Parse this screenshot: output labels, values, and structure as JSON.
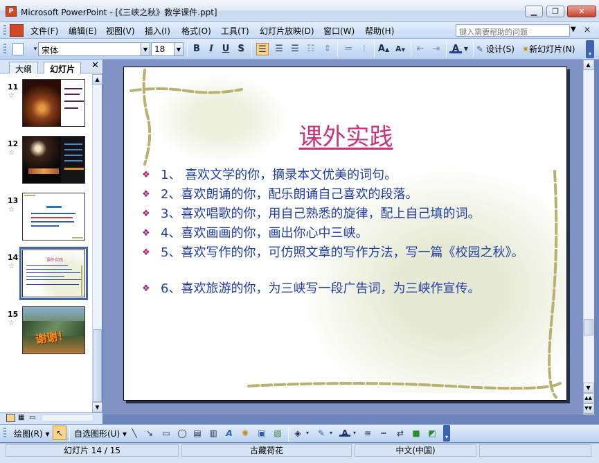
{
  "window": {
    "app_icon_letter": "P",
    "title": "Microsoft PowerPoint - [《三峡之秋》教学课件.ppt]",
    "min_label": "▁",
    "max_label": "❐",
    "close_label": "✕"
  },
  "menu": {
    "items": [
      "文件(F)",
      "编辑(E)",
      "视图(V)",
      "插入(I)",
      "格式(O)",
      "工具(T)",
      "幻灯片放映(D)",
      "窗口(W)",
      "帮助(H)"
    ],
    "help_placeholder": "键入需要帮助的问题",
    "doc_close": "✕"
  },
  "toolbar": {
    "font_name": "宋体",
    "font_size": "18",
    "bold": "B",
    "italic": "I",
    "underline": "U",
    "shadow": "S",
    "design_label": "设计(S)",
    "new_slide_label": "新幻灯片(N)"
  },
  "left_panel": {
    "tab_outline": "大纲",
    "tab_slides": "幻灯片",
    "close": "✕",
    "thumbnails": [
      {
        "num": "11",
        "star": "☆"
      },
      {
        "num": "12",
        "star": "☆"
      },
      {
        "num": "13",
        "star": "☆"
      },
      {
        "num": "14",
        "star": "☆"
      },
      {
        "num": "15",
        "star": "☆"
      }
    ],
    "thumb14_title": "课外实践",
    "thumb15_text": "谢谢！"
  },
  "slide": {
    "title": "课外实践",
    "bullet_mark": "❖",
    "bullets": [
      "1、 喜欢文学的你，摘录本文优美的词句。",
      "2、喜欢朗诵的你，配乐朗诵自己喜欢的段落。",
      "3、喜欢唱歌的你，用自己熟悉的旋律，配上自己填的词。",
      "4、喜欢画画的你，画出你心中三峡。",
      "5、喜欢写作的你，可仿照文章的写作方法，写一篇《校园之秋》。",
      "6、喜欢旅游的你，为三峡写一段广告词，为三峡作宣传。"
    ]
  },
  "drawing_toolbar": {
    "draw_label": "绘图(R)",
    "autoshapes_label": "自选图形(U)"
  },
  "status": {
    "slide_indicator": "幻灯片 14 / 15",
    "design_name": "古藏荷花",
    "language": "中文(中国)"
  },
  "colors": {
    "title": "#c7357b",
    "body_text": "#1f3ea6",
    "bullet": "#a71e76",
    "vine": "#b8b26e"
  }
}
